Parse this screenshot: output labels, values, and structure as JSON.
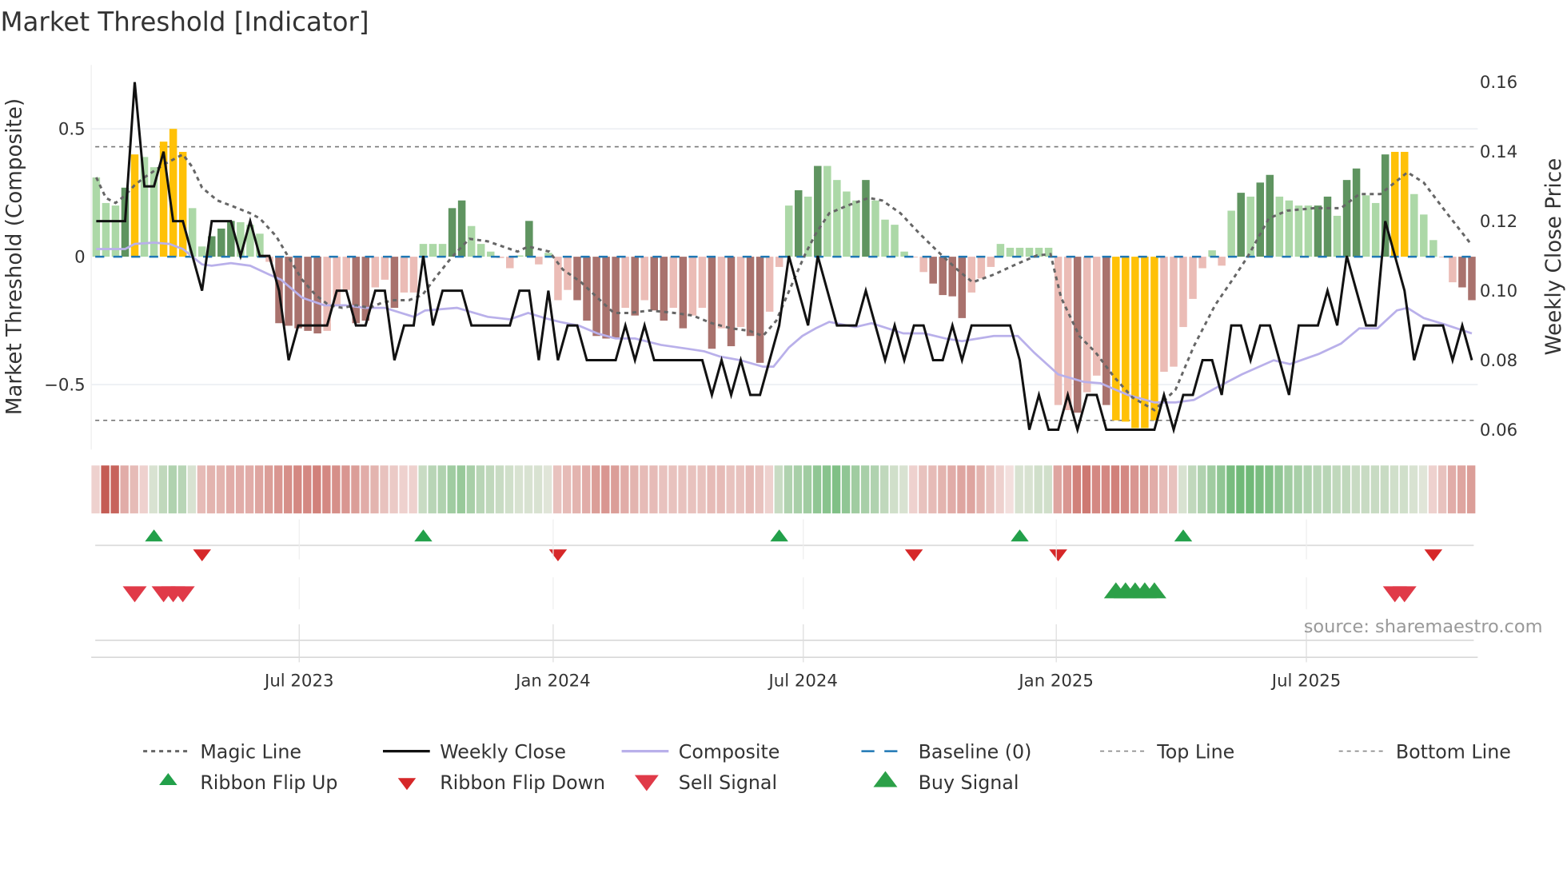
{
  "chart_data": {
    "type": "bar",
    "title": "Market Threshold [Indicator]",
    "ylabel": "Market Threshold (Composite)",
    "y2label": "Weekly Close Price",
    "source": "source: sharemaestro.com",
    "ylim": [
      -0.75,
      0.75
    ],
    "y2lim": [
      0.055,
      0.165
    ],
    "yticks": [
      {
        "v": 0.5,
        "label": "0.5"
      },
      {
        "v": 0,
        "label": "0"
      },
      {
        "v": -0.5,
        "label": "−0.5"
      }
    ],
    "y2ticks": [
      {
        "v": 0.16,
        "label": "0.16"
      },
      {
        "v": 0.14,
        "label": "0.14"
      },
      {
        "v": 0.12,
        "label": "0.12"
      },
      {
        "v": 0.1,
        "label": "0.10"
      },
      {
        "v": 0.08,
        "label": "0.08"
      },
      {
        "v": 0.06,
        "label": "0.06"
      }
    ],
    "xticks": [
      {
        "week": 21.1,
        "label": "Jul 2023"
      },
      {
        "week": 47.5,
        "label": "Jan 2024"
      },
      {
        "week": 73.5,
        "label": "Jul 2024"
      },
      {
        "week": 99.8,
        "label": "Jan 2025"
      },
      {
        "week": 125.8,
        "label": "Jul 2025"
      }
    ],
    "top_line": 0.43,
    "bottom_line": -0.64,
    "baseline": 0,
    "colors": {
      "L": "#acd8a7",
      "G": "#5f9460",
      "Y": "#ffc107",
      "P": "#ebbcb6",
      "D": "#a9726d",
      "close": "#111111",
      "magic": "#666666",
      "composite": "#b9b0ea",
      "baseline": "#1f77b4",
      "flip_up": "#22a04a",
      "flip_down": "#d62728",
      "sell": "#e03a48",
      "buy": "#2ca048"
    },
    "composite_bars": [
      [
        0.31,
        "L"
      ],
      [
        0.21,
        "L"
      ],
      [
        0.2,
        "L"
      ],
      [
        0.27,
        "G"
      ],
      [
        0.4,
        "Y"
      ],
      [
        0.39,
        "L"
      ],
      [
        0.35,
        "L"
      ],
      [
        0.45,
        "Y"
      ],
      [
        0.5,
        "Y"
      ],
      [
        0.41,
        "Y"
      ],
      [
        0.19,
        "L"
      ],
      [
        0.04,
        "L"
      ],
      [
        0.08,
        "G"
      ],
      [
        0.11,
        "G"
      ],
      [
        0.14,
        "G"
      ],
      [
        0.135,
        "L"
      ],
      [
        0.125,
        "L"
      ],
      [
        0.09,
        "L"
      ],
      [
        -0.02,
        "P"
      ],
      [
        -0.26,
        "D"
      ],
      [
        -0.27,
        "D"
      ],
      [
        -0.28,
        "D"
      ],
      [
        -0.29,
        "D"
      ],
      [
        -0.3,
        "D"
      ],
      [
        -0.29,
        "P"
      ],
      [
        -0.19,
        "P"
      ],
      [
        -0.13,
        "P"
      ],
      [
        -0.26,
        "D"
      ],
      [
        -0.25,
        "D"
      ],
      [
        -0.12,
        "P"
      ],
      [
        -0.09,
        "P"
      ],
      [
        -0.2,
        "D"
      ],
      [
        -0.14,
        "P"
      ],
      [
        -0.14,
        "P"
      ],
      [
        0.05,
        "L"
      ],
      [
        0.05,
        "L"
      ],
      [
        0.05,
        "L"
      ],
      [
        0.19,
        "G"
      ],
      [
        0.22,
        "G"
      ],
      [
        0.12,
        "L"
      ],
      [
        0.05,
        "L"
      ],
      [
        0.02,
        "L"
      ],
      [
        -0.005,
        "P"
      ],
      [
        -0.045,
        "P"
      ],
      [
        0.005,
        "L"
      ],
      [
        0.14,
        "G"
      ],
      [
        -0.03,
        "P"
      ],
      [
        0.015,
        "L"
      ],
      [
        -0.17,
        "P"
      ],
      [
        -0.13,
        "P"
      ],
      [
        -0.17,
        "D"
      ],
      [
        -0.25,
        "D"
      ],
      [
        -0.31,
        "D"
      ],
      [
        -0.32,
        "D"
      ],
      [
        -0.32,
        "D"
      ],
      [
        -0.2,
        "P"
      ],
      [
        -0.23,
        "D"
      ],
      [
        -0.17,
        "P"
      ],
      [
        -0.21,
        "D"
      ],
      [
        -0.25,
        "D"
      ],
      [
        -0.2,
        "P"
      ],
      [
        -0.28,
        "D"
      ],
      [
        -0.23,
        "P"
      ],
      [
        -0.2,
        "P"
      ],
      [
        -0.36,
        "D"
      ],
      [
        -0.28,
        "P"
      ],
      [
        -0.35,
        "D"
      ],
      [
        -0.275,
        "P"
      ],
      [
        -0.31,
        "D"
      ],
      [
        -0.415,
        "D"
      ],
      [
        -0.215,
        "P"
      ],
      [
        -0.04,
        "P"
      ],
      [
        0.2,
        "L"
      ],
      [
        0.26,
        "G"
      ],
      [
        0.235,
        "L"
      ],
      [
        0.355,
        "G"
      ],
      [
        0.355,
        "L"
      ],
      [
        0.3,
        "L"
      ],
      [
        0.255,
        "L"
      ],
      [
        0.22,
        "L"
      ],
      [
        0.3,
        "G"
      ],
      [
        0.22,
        "L"
      ],
      [
        0.145,
        "L"
      ],
      [
        0.125,
        "L"
      ],
      [
        0.02,
        "L"
      ],
      [
        -0.003,
        "P"
      ],
      [
        -0.06,
        "P"
      ],
      [
        -0.105,
        "D"
      ],
      [
        -0.15,
        "D"
      ],
      [
        -0.155,
        "D"
      ],
      [
        -0.24,
        "D"
      ],
      [
        -0.14,
        "P"
      ],
      [
        -0.085,
        "P"
      ],
      [
        -0.04,
        "P"
      ],
      [
        0.05,
        "L"
      ],
      [
        0.035,
        "L"
      ],
      [
        0.035,
        "L"
      ],
      [
        0.035,
        "L"
      ],
      [
        0.035,
        "L"
      ],
      [
        0.035,
        "L"
      ],
      [
        -0.58,
        "P"
      ],
      [
        -0.6,
        "P"
      ],
      [
        -0.61,
        "D"
      ],
      [
        -0.53,
        "P"
      ],
      [
        -0.465,
        "P"
      ],
      [
        -0.58,
        "D"
      ],
      [
        -0.64,
        "Y"
      ],
      [
        -0.645,
        "Y"
      ],
      [
        -0.67,
        "Y"
      ],
      [
        -0.67,
        "Y"
      ],
      [
        -0.64,
        "Y"
      ],
      [
        -0.45,
        "P"
      ],
      [
        -0.43,
        "P"
      ],
      [
        -0.275,
        "P"
      ],
      [
        -0.165,
        "P"
      ],
      [
        -0.045,
        "P"
      ],
      [
        0.025,
        "L"
      ],
      [
        -0.035,
        "P"
      ],
      [
        0.18,
        "L"
      ],
      [
        0.25,
        "G"
      ],
      [
        0.235,
        "L"
      ],
      [
        0.29,
        "G"
      ],
      [
        0.32,
        "G"
      ],
      [
        0.235,
        "L"
      ],
      [
        0.22,
        "L"
      ],
      [
        0.2,
        "L"
      ],
      [
        0.2,
        "L"
      ],
      [
        0.2,
        "G"
      ],
      [
        0.235,
        "G"
      ],
      [
        0.16,
        "L"
      ],
      [
        0.3,
        "G"
      ],
      [
        0.345,
        "G"
      ],
      [
        0.24,
        "L"
      ],
      [
        0.21,
        "L"
      ],
      [
        0.4,
        "G"
      ],
      [
        0.41,
        "Y"
      ],
      [
        0.41,
        "Y"
      ],
      [
        0.245,
        "L"
      ],
      [
        0.165,
        "L"
      ],
      [
        0.065,
        "L"
      ],
      [
        -0.003,
        "P"
      ],
      [
        -0.1,
        "P"
      ],
      [
        -0.12,
        "D"
      ],
      [
        -0.17,
        "D"
      ]
    ],
    "weekly_close": [
      0.12,
      0.12,
      0.12,
      0.12,
      0.16,
      0.13,
      0.13,
      0.14,
      0.12,
      0.12,
      0.11,
      0.1,
      0.12,
      0.12,
      0.12,
      0.11,
      0.12,
      0.11,
      0.11,
      0.1,
      0.08,
      0.09,
      0.09,
      0.09,
      0.09,
      0.1,
      0.1,
      0.09,
      0.09,
      0.1,
      0.1,
      0.08,
      0.09,
      0.09,
      0.11,
      0.09,
      0.1,
      0.1,
      0.1,
      0.09,
      0.09,
      0.09,
      0.09,
      0.09,
      0.1,
      0.1,
      0.08,
      0.1,
      0.08,
      0.09,
      0.09,
      0.08,
      0.08,
      0.08,
      0.08,
      0.09,
      0.08,
      0.09,
      0.08,
      0.08,
      0.08,
      0.08,
      0.08,
      0.08,
      0.07,
      0.08,
      0.07,
      0.08,
      0.07,
      0.07,
      0.08,
      0.09,
      0.11,
      0.1,
      0.09,
      0.11,
      0.1,
      0.09,
      0.09,
      0.09,
      0.1,
      0.09,
      0.08,
      0.09,
      0.08,
      0.09,
      0.09,
      0.08,
      0.08,
      0.09,
      0.08,
      0.09,
      0.09,
      0.09,
      0.09,
      0.09,
      0.08,
      0.06,
      0.07,
      0.06,
      0.06,
      0.07,
      0.06,
      0.07,
      0.07,
      0.06,
      0.06,
      0.06,
      0.06,
      0.06,
      0.06,
      0.07,
      0.06,
      0.07,
      0.07,
      0.08,
      0.08,
      0.07,
      0.09,
      0.09,
      0.08,
      0.09,
      0.09,
      0.08,
      0.07,
      0.09,
      0.09,
      0.09,
      0.1,
      0.09,
      0.11,
      0.1,
      0.09,
      0.09,
      0.12,
      0.11,
      0.1,
      0.08,
      0.09,
      0.09,
      0.09,
      0.08,
      0.09,
      0.08
    ],
    "magic_line": [
      [
        0,
        0.31
      ],
      [
        1,
        0.23
      ],
      [
        2,
        0.21
      ],
      [
        3,
        0.24
      ],
      [
        4,
        0.28
      ],
      [
        5,
        0.31
      ],
      [
        7,
        0.36
      ],
      [
        9,
        0.4
      ],
      [
        10,
        0.35
      ],
      [
        11,
        0.27
      ],
      [
        12.6,
        0.22
      ],
      [
        14,
        0.2
      ],
      [
        16,
        0.17
      ],
      [
        17,
        0.15
      ],
      [
        18.7,
        0.08
      ],
      [
        19.8,
        0.01
      ],
      [
        21.4,
        -0.09
      ],
      [
        22.8,
        -0.15
      ],
      [
        24.2,
        -0.19
      ],
      [
        25.6,
        -0.2
      ],
      [
        27,
        -0.19
      ],
      [
        28.4,
        -0.2
      ],
      [
        29.7,
        -0.18
      ],
      [
        31,
        -0.17
      ],
      [
        32.5,
        -0.17
      ],
      [
        33.9,
        -0.15
      ],
      [
        35.3,
        -0.08
      ],
      [
        37,
        0
      ],
      [
        38.8,
        0.07
      ],
      [
        40.7,
        0.06
      ],
      [
        43.8,
        0.02
      ],
      [
        44.9,
        0.04
      ],
      [
        47.1,
        0.02
      ],
      [
        48.5,
        -0.05
      ],
      [
        50.4,
        -0.1
      ],
      [
        52.1,
        -0.16
      ],
      [
        53.8,
        -0.22
      ],
      [
        55.4,
        -0.22
      ],
      [
        57.6,
        -0.21
      ],
      [
        60.1,
        -0.22
      ],
      [
        62,
        -0.23
      ],
      [
        64,
        -0.26
      ],
      [
        66,
        -0.28
      ],
      [
        67.9,
        -0.29
      ],
      [
        69.3,
        -0.31
      ],
      [
        70.7,
        -0.25
      ],
      [
        72.3,
        -0.11
      ],
      [
        73.7,
        0.01
      ],
      [
        74.8,
        0.09
      ],
      [
        76.2,
        0.17
      ],
      [
        78.1,
        0.2
      ],
      [
        80.3,
        0.23
      ],
      [
        81.7,
        0.22
      ],
      [
        83.6,
        0.17
      ],
      [
        85.6,
        0.09
      ],
      [
        87.5,
        0.02
      ],
      [
        89.5,
        -0.05
      ],
      [
        91.1,
        -0.1
      ],
      [
        93.3,
        -0.07
      ],
      [
        95.6,
        -0.03
      ],
      [
        97.8,
        0.005
      ],
      [
        99.2,
        0.01
      ],
      [
        100.3,
        -0.16
      ],
      [
        102.2,
        -0.31
      ],
      [
        103.9,
        -0.375
      ],
      [
        105.8,
        -0.47
      ],
      [
        107.7,
        -0.55
      ],
      [
        110,
        -0.6
      ],
      [
        112.2,
        -0.52
      ],
      [
        114.1,
        -0.35
      ],
      [
        116.3,
        -0.19
      ],
      [
        118.3,
        -0.08
      ],
      [
        119.7,
        0
      ],
      [
        121.9,
        0.15
      ],
      [
        123.8,
        0.18
      ],
      [
        126.6,
        0.19
      ],
      [
        129.4,
        0.19
      ],
      [
        131.3,
        0.245
      ],
      [
        133.5,
        0.245
      ],
      [
        136.3,
        0.33
      ],
      [
        138,
        0.29
      ],
      [
        140.2,
        0.18
      ],
      [
        142.9,
        0.05
      ]
    ],
    "composite_line": [
      [
        0,
        0.03
      ],
      [
        3,
        0.03
      ],
      [
        4,
        0.05
      ],
      [
        6,
        0.055
      ],
      [
        7.6,
        0.05
      ],
      [
        9,
        0.03
      ],
      [
        11,
        -0.03
      ],
      [
        12,
        -0.035
      ],
      [
        14,
        -0.025
      ],
      [
        16,
        -0.035
      ],
      [
        18,
        -0.07
      ],
      [
        19.2,
        -0.09
      ],
      [
        21.4,
        -0.16
      ],
      [
        23.7,
        -0.19
      ],
      [
        25.9,
        -0.19
      ],
      [
        28,
        -0.2
      ],
      [
        30,
        -0.2
      ],
      [
        33,
        -0.235
      ],
      [
        34.2,
        -0.21
      ],
      [
        37.5,
        -0.2
      ],
      [
        40.7,
        -0.235
      ],
      [
        43,
        -0.245
      ],
      [
        44.9,
        -0.22
      ],
      [
        46.6,
        -0.24
      ],
      [
        48.2,
        -0.255
      ],
      [
        50.2,
        -0.27
      ],
      [
        52.1,
        -0.3
      ],
      [
        54,
        -0.32
      ],
      [
        56,
        -0.32
      ],
      [
        58.7,
        -0.345
      ],
      [
        61.5,
        -0.36
      ],
      [
        63.2,
        -0.37
      ],
      [
        64.8,
        -0.39
      ],
      [
        67,
        -0.405
      ],
      [
        69.3,
        -0.43
      ],
      [
        70.4,
        -0.43
      ],
      [
        72,
        -0.355
      ],
      [
        73.4,
        -0.31
      ],
      [
        74.8,
        -0.28
      ],
      [
        76.2,
        -0.255
      ],
      [
        78.9,
        -0.275
      ],
      [
        80.6,
        -0.26
      ],
      [
        83.9,
        -0.3
      ],
      [
        86.1,
        -0.3
      ],
      [
        88.3,
        -0.32
      ],
      [
        90,
        -0.33
      ],
      [
        93.3,
        -0.31
      ],
      [
        95.8,
        -0.31
      ],
      [
        97.5,
        -0.375
      ],
      [
        100,
        -0.46
      ],
      [
        102.7,
        -0.49
      ],
      [
        104.4,
        -0.495
      ],
      [
        107.2,
        -0.54
      ],
      [
        110,
        -0.57
      ],
      [
        112.2,
        -0.57
      ],
      [
        114.1,
        -0.56
      ],
      [
        116.3,
        -0.515
      ],
      [
        119.1,
        -0.46
      ],
      [
        122.4,
        -0.405
      ],
      [
        124.1,
        -0.42
      ],
      [
        127.1,
        -0.38
      ],
      [
        129.4,
        -0.34
      ],
      [
        131.3,
        -0.28
      ],
      [
        133.2,
        -0.28
      ],
      [
        135.2,
        -0.21
      ],
      [
        136.3,
        -0.2
      ],
      [
        138,
        -0.24
      ],
      [
        140.2,
        -0.265
      ],
      [
        143,
        -0.3
      ]
    ],
    "ribbon_strength": [
      -0.2,
      -1,
      -0.95,
      -0.45,
      -0.35,
      -0.2,
      0.2,
      0.35,
      0.45,
      0.4,
      0.2,
      -0.35,
      -0.4,
      -0.4,
      -0.45,
      -0.45,
      -0.45,
      -0.5,
      -0.55,
      -0.6,
      -0.65,
      -0.7,
      -0.7,
      -0.75,
      -0.7,
      -0.65,
      -0.6,
      -0.55,
      -0.45,
      -0.4,
      -0.3,
      -0.25,
      -0.2,
      -0.2,
      0.3,
      0.4,
      0.45,
      0.55,
      0.6,
      0.5,
      0.4,
      0.35,
      0.3,
      0.25,
      0.2,
      0.2,
      0.2,
      0.15,
      -0.3,
      -0.35,
      -0.4,
      -0.45,
      -0.55,
      -0.6,
      -0.55,
      -0.45,
      -0.4,
      -0.35,
      -0.35,
      -0.3,
      -0.3,
      -0.3,
      -0.3,
      -0.3,
      -0.35,
      -0.35,
      -0.3,
      -0.3,
      -0.35,
      -0.3,
      -0.2,
      0.3,
      0.45,
      0.5,
      0.55,
      0.65,
      0.7,
      0.75,
      0.65,
      0.55,
      0.5,
      0.45,
      0.35,
      0.25,
      0.2,
      -0.2,
      -0.3,
      -0.35,
      -0.4,
      -0.45,
      -0.5,
      -0.5,
      -0.4,
      -0.3,
      -0.2,
      -0.1,
      0.2,
      0.2,
      0.25,
      0.25,
      -0.5,
      -0.6,
      -0.75,
      -0.8,
      -0.7,
      -0.7,
      -0.75,
      -0.7,
      -0.6,
      -0.55,
      -0.45,
      -0.35,
      -0.3,
      0.2,
      0.35,
      0.45,
      0.55,
      0.65,
      0.8,
      0.85,
      0.85,
      0.8,
      0.75,
      0.65,
      0.55,
      0.5,
      0.45,
      0.4,
      0.4,
      0.35,
      0.35,
      0.3,
      0.3,
      0.3,
      0.3,
      0.25,
      0.25,
      0.2,
      0.15,
      -0.2,
      -0.3,
      -0.45,
      -0.5,
      -0.55
    ],
    "ribbon_flip_up_weeks": [
      6,
      34,
      71,
      96,
      113
    ],
    "ribbon_flip_down_weeks": [
      11,
      48,
      85,
      100,
      139
    ],
    "sell_signal_weeks": [
      4,
      7,
      8,
      9,
      135,
      136
    ],
    "buy_signal_weeks": [
      106,
      107,
      108,
      109,
      110
    ],
    "legend": [
      {
        "key": "magic",
        "label": "Magic Line",
        "style": "dotted"
      },
      {
        "key": "close",
        "label": "Weekly Close",
        "style": "solid"
      },
      {
        "key": "composite",
        "label": "Composite",
        "style": "solid-light"
      },
      {
        "key": "baseline",
        "label": "Baseline (0)",
        "style": "dashed"
      },
      {
        "key": "top",
        "label": "Top Line",
        "style": "dashed-thin"
      },
      {
        "key": "bottom",
        "label": "Bottom Line",
        "style": "dashed-thin"
      },
      {
        "key": "flip_up",
        "label": "Ribbon Flip Up",
        "style": "tri-up"
      },
      {
        "key": "flip_down",
        "label": "Ribbon Flip Down",
        "style": "tri-down"
      },
      {
        "key": "sell",
        "label": "Sell Signal",
        "style": "tri-down-big"
      },
      {
        "key": "buy",
        "label": "Buy Signal",
        "style": "tri-up-big"
      }
    ]
  }
}
